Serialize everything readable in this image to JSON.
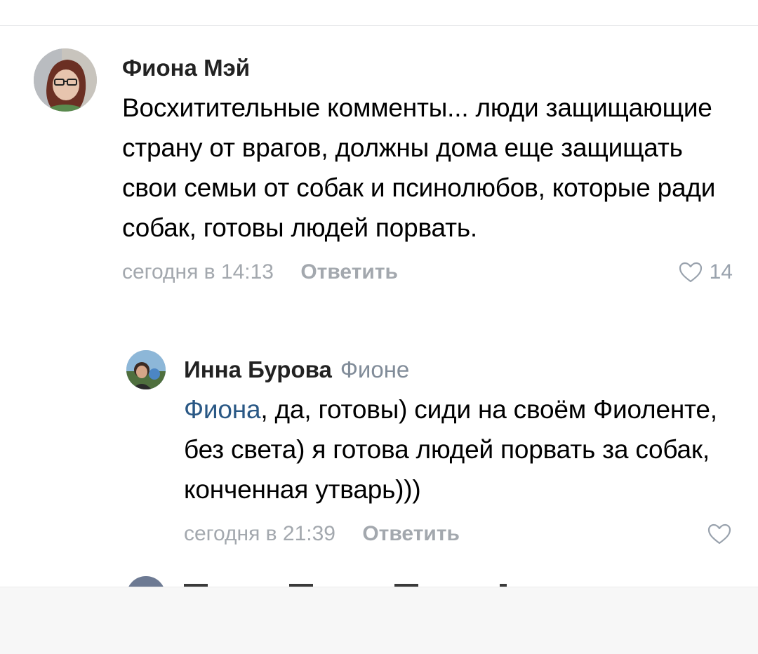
{
  "comments": [
    {
      "author": "Фиона Мэй",
      "addressee": "",
      "mention": "",
      "text": "Восхитительные комменты... люди защищающие страну от врагов, должны дома еще защищать свои семьи от собак и псинолюбов, которые ради собак, готовы людей порвать.",
      "timestamp": "сегодня в 14:13",
      "reply_label": "Ответить",
      "likes": "14",
      "avatar_icon": "user-photo-avatar"
    },
    {
      "author": "Инна Бурова",
      "addressee": "Фионе",
      "mention": "Фиона",
      "text": ", да, готовы) сиди на своём Фиоленте, без света) я готова людей порвать за собак, конченная утварь)))",
      "timestamp": "сегодня в 21:39",
      "reply_label": "Ответить",
      "likes": "",
      "avatar_icon": "user-photo-avatar"
    }
  ],
  "icons": {
    "like": "heart-outline-icon"
  },
  "colors": {
    "mention": "#2a5885",
    "meta": "#a3a8ae",
    "author": "#222222",
    "text": "#000000"
  }
}
